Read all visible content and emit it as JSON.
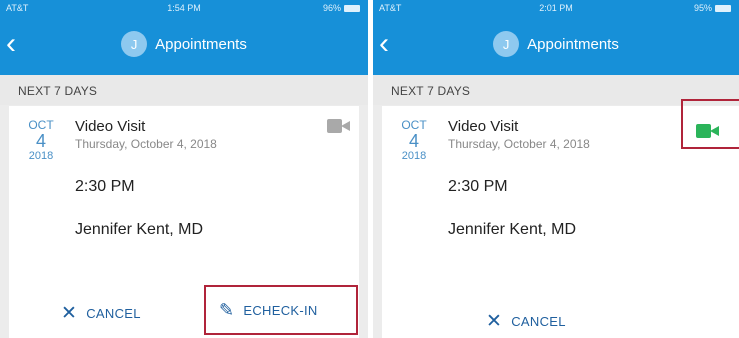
{
  "left": {
    "status": {
      "carrier": "AT&T",
      "time": "1:54 PM",
      "battery": "96%"
    },
    "nav": {
      "back_label": "‹",
      "avatar_letter": "J",
      "title": "Appointments"
    },
    "section_header": "NEXT 7 DAYS",
    "appointment": {
      "month": "OCT",
      "day": "4",
      "year": "2018",
      "type": "Video Visit",
      "full_date": "Thursday, October 4, 2018",
      "time": "2:30 PM",
      "provider": "Jennifer Kent, MD"
    },
    "video_icon": {
      "name": "video-camera-icon",
      "color": "#a9a9a9"
    },
    "actions": {
      "cancel": "CANCEL",
      "echeckin": "ECHECK-IN"
    }
  },
  "right": {
    "status": {
      "carrier": "AT&T",
      "time": "2:01 PM",
      "battery": "95%"
    },
    "nav": {
      "back_label": "‹",
      "avatar_letter": "J",
      "title": "Appointments"
    },
    "section_header": "NEXT 7 DAYS",
    "appointment": {
      "month": "OCT",
      "day": "4",
      "year": "2018",
      "type": "Video Visit",
      "full_date": "Thursday, October 4, 2018",
      "time": "2:30 PM",
      "provider": "Jennifer Kent, MD"
    },
    "video_icon": {
      "name": "video-camera-icon",
      "color": "#2bb45a"
    },
    "actions": {
      "cancel": "CANCEL"
    }
  },
  "colors": {
    "brand_blue": "#1790d8",
    "link_blue": "#1f5f9e",
    "highlight_red": "#b0243a"
  }
}
